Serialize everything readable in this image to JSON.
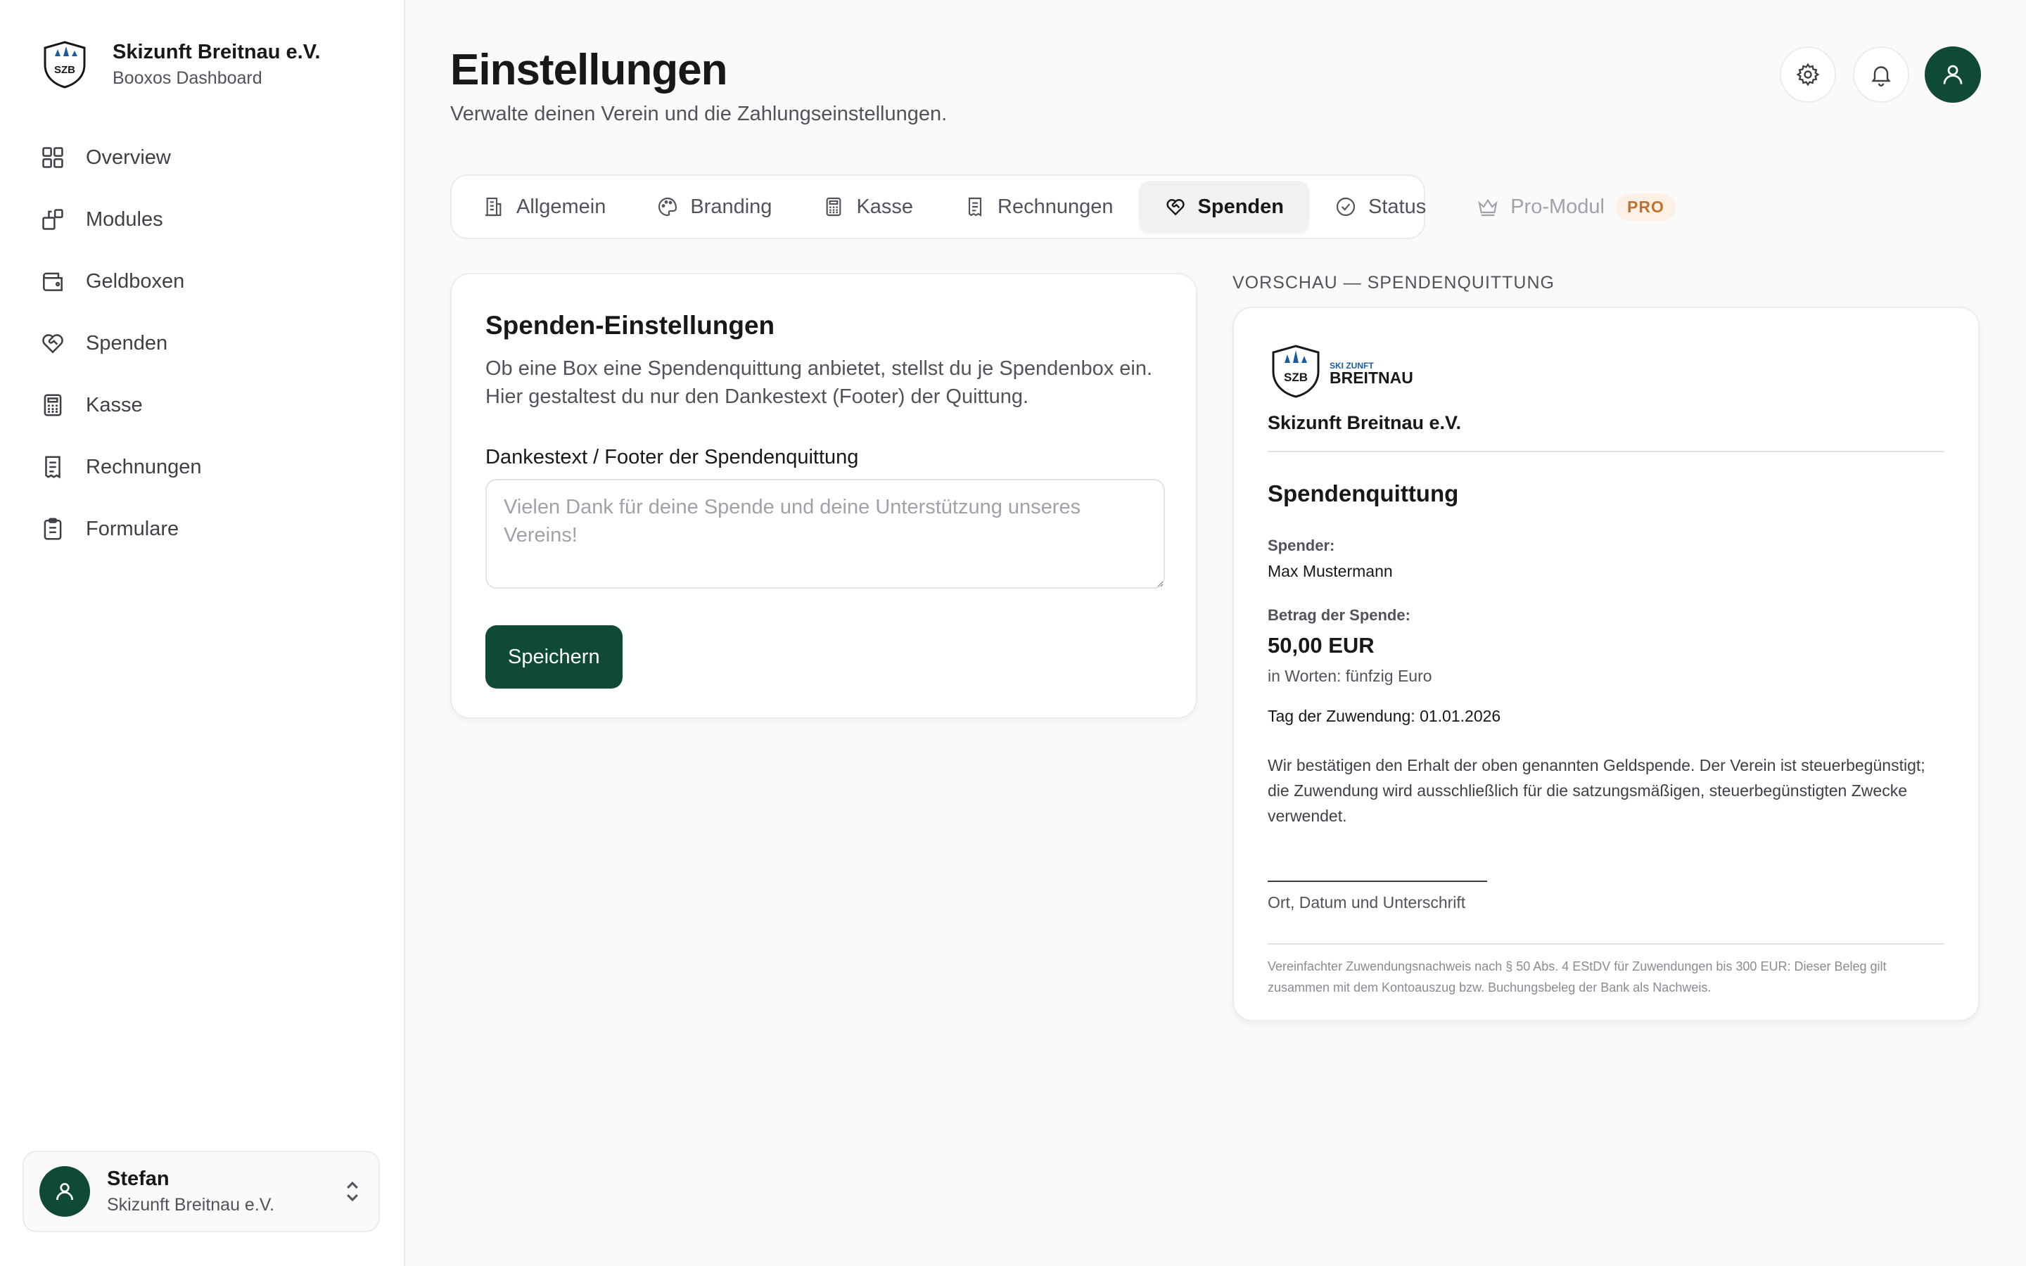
{
  "brand": {
    "name": "Skizunft Breitnau e.V.",
    "subtitle": "Booxos Dashboard",
    "logo_text": "SZB"
  },
  "sidebar": {
    "items": [
      {
        "label": "Overview",
        "icon": "grid-icon"
      },
      {
        "label": "Modules",
        "icon": "modules-icon"
      },
      {
        "label": "Geldboxen",
        "icon": "wallet-icon"
      },
      {
        "label": "Spenden",
        "icon": "heart-handshake-icon"
      },
      {
        "label": "Kasse",
        "icon": "calculator-icon"
      },
      {
        "label": "Rechnungen",
        "icon": "receipt-icon"
      },
      {
        "label": "Formulare",
        "icon": "clipboard-icon"
      }
    ]
  },
  "user": {
    "name": "Stefan",
    "org": "Skizunft Breitnau e.V."
  },
  "page": {
    "title": "Einstellungen",
    "subtitle": "Verwalte deinen Verein und die Zahlungseinstellungen."
  },
  "tabs": [
    {
      "label": "Allgemein",
      "icon": "building-icon",
      "state": "normal"
    },
    {
      "label": "Branding",
      "icon": "palette-icon",
      "state": "normal"
    },
    {
      "label": "Kasse",
      "icon": "calculator-icon",
      "state": "normal"
    },
    {
      "label": "Rechnungen",
      "icon": "receipt-icon",
      "state": "normal"
    },
    {
      "label": "Spenden",
      "icon": "heart-handshake-icon",
      "state": "active"
    },
    {
      "label": "Status",
      "icon": "check-circle-icon",
      "state": "normal"
    },
    {
      "label": "Pro-Modul",
      "icon": "crown-icon",
      "state": "disabled",
      "badge": "PRO"
    }
  ],
  "settings": {
    "title": "Spenden-Einstellungen",
    "description": "Ob eine Box eine Spendenquittung anbietet, stellst du je Spendenbox ein. Hier gestaltest du nur den Dankestext (Footer) der Quittung.",
    "field_label": "Dankestext / Footer der Spendenquittung",
    "textarea_value": "",
    "textarea_placeholder": "Vielen Dank für deine Spende und deine Unterstützung unseres Vereins!",
    "save_label": "Speichern"
  },
  "preview": {
    "label": "VORSCHAU — SPENDENQUITTUNG",
    "logo_small": "SKI ZUNFT",
    "logo_big": "BREITNAU",
    "org": "Skizunft Breitnau e.V.",
    "title": "Spendenquittung",
    "donor_label": "Spender:",
    "donor_name": "Max Mustermann",
    "amount_label": "Betrag der Spende:",
    "amount": "50,00 EUR",
    "amount_words": "in Worten: fünfzig Euro",
    "date_line": "Tag der Zuwendung: 01.01.2026",
    "confirmation": "Wir bestätigen den Erhalt der oben genannten Geldspende. Der Verein ist steuerbegünstigt; die Zuwendung wird ausschließlich für die satzungsmäßigen, steuerbegünstigten Zwecke verwendet.",
    "signature_caption": "Ort, Datum und Unterschrift",
    "footer_note": "Vereinfachter Zuwendungsnachweis nach § 50 Abs. 4 EStDV für Zuwendungen bis 300 EUR: Dieser Beleg gilt zusammen mit dem Kontoauszug bzw. Buchungsbeleg der Bank als Nachweis."
  },
  "colors": {
    "primary": "#0f4a36",
    "pro_badge_bg": "#fdf1e6",
    "pro_badge_text": "#c0732e",
    "logo_tree": "#1e5aa0"
  }
}
